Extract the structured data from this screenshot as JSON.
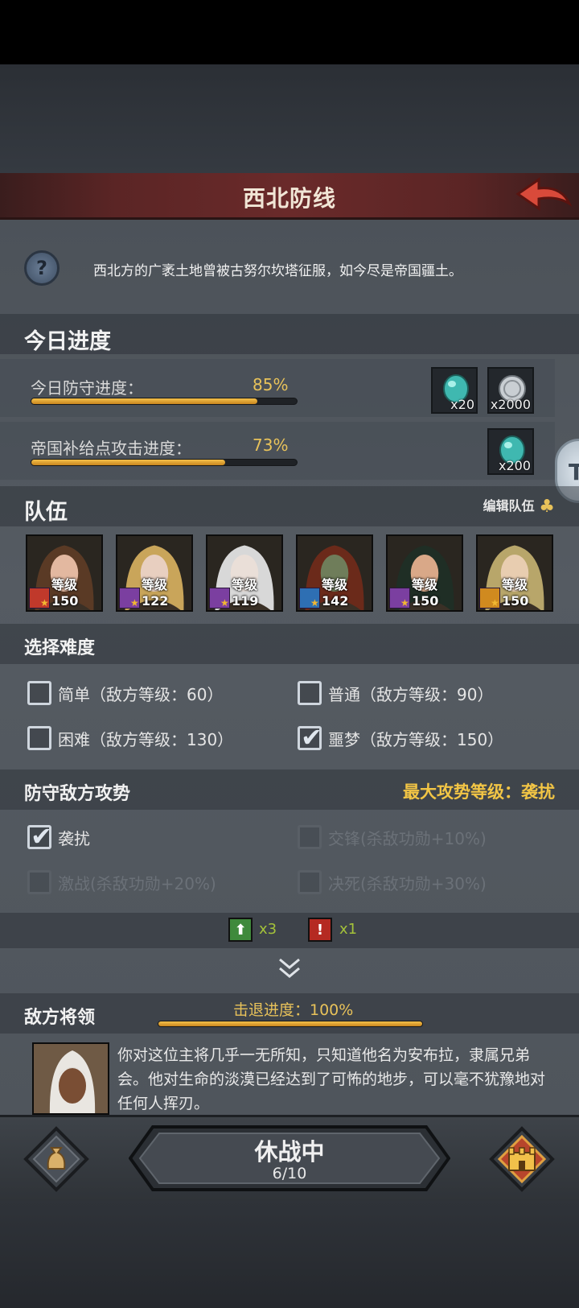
{
  "header": {
    "title": "西北防线"
  },
  "intro": {
    "text": "西北方的广袤土地曾被古努尔坎塔征服，如今尽是帝国疆土。"
  },
  "side_tab": {
    "label": "T"
  },
  "today": {
    "title": "今日进度",
    "defense": {
      "label": "今日防守进度：",
      "percent_text": "85%",
      "progress": 0.85,
      "rewards": [
        {
          "icon": "turquoise-gem-icon",
          "qty": "x20"
        },
        {
          "icon": "silver-coin-icon",
          "qty": "x2000"
        }
      ]
    },
    "supply": {
      "label": "帝国补给点攻击进度：",
      "percent_text": "73%",
      "progress": 0.73,
      "rewards": [
        {
          "icon": "turquoise-gem-icon",
          "qty": "x200"
        }
      ]
    }
  },
  "team": {
    "title": "队伍",
    "edit_label": "编辑队伍",
    "heroes": [
      {
        "level": "等级150",
        "class_icon": "horse-icon",
        "class_color": "#c0392b"
      },
      {
        "level": "等级122",
        "class_icon": "staff-icon",
        "class_color": "#7b3fa0"
      },
      {
        "level": "等级119",
        "class_icon": "staff-icon",
        "class_color": "#7b3fa0"
      },
      {
        "level": "等级142",
        "class_icon": "sword-icon",
        "class_color": "#2e6fb3"
      },
      {
        "level": "等级150",
        "class_icon": "staff-icon",
        "class_color": "#7b3fa0"
      },
      {
        "level": "等级150",
        "class_icon": "heal-icon",
        "class_color": "#d08a1f"
      }
    ]
  },
  "difficulty": {
    "title": "选择难度",
    "options": [
      {
        "label": "简单（敌方等级：60）",
        "checked": false
      },
      {
        "label": "普通（敌方等级：90）",
        "checked": false
      },
      {
        "label": "困难（敌方等级：130）",
        "checked": false
      },
      {
        "label": "噩梦（敌方等级：150）",
        "checked": true
      }
    ]
  },
  "offense": {
    "title": "防守敌方攻势",
    "max_level": "最大攻势等级：袭扰",
    "options": [
      {
        "label": "袭扰",
        "checked": true,
        "enabled": true
      },
      {
        "label": "交锋(杀敌功勋+10%)",
        "checked": false,
        "enabled": false
      },
      {
        "label": "激战(杀敌功勋+20%)",
        "checked": false,
        "enabled": false
      },
      {
        "label": "决死(杀敌功勋+30%)",
        "checked": false,
        "enabled": false
      }
    ],
    "badges": [
      {
        "symbol": "⬆",
        "count": "x3"
      },
      {
        "symbol": "!",
        "count": "x1"
      }
    ]
  },
  "boss": {
    "title": "敌方将领",
    "repel_label": "击退进度：100%",
    "repel_progress": 1.0,
    "description": "你对这位主将几乎一无所知，只知道他名为安布拉，隶属兄弟会。他对生命的淡漠已经达到了可怖的地步，可以毫不犹豫地对任何人挥刃。"
  },
  "bottom": {
    "status": "休战中",
    "count": "6/10"
  },
  "colors": {
    "accent_gold": "#e8c25a",
    "header_red": "#6a2a2a"
  }
}
